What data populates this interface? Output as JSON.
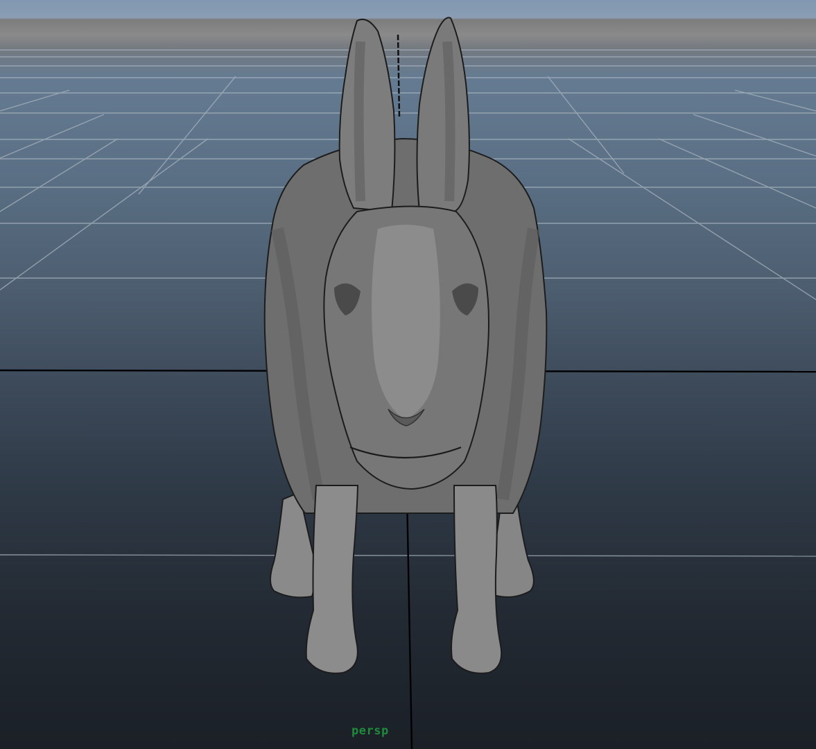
{
  "viewport": {
    "camera_label": "persp"
  },
  "model": {
    "name": "rabbit"
  }
}
